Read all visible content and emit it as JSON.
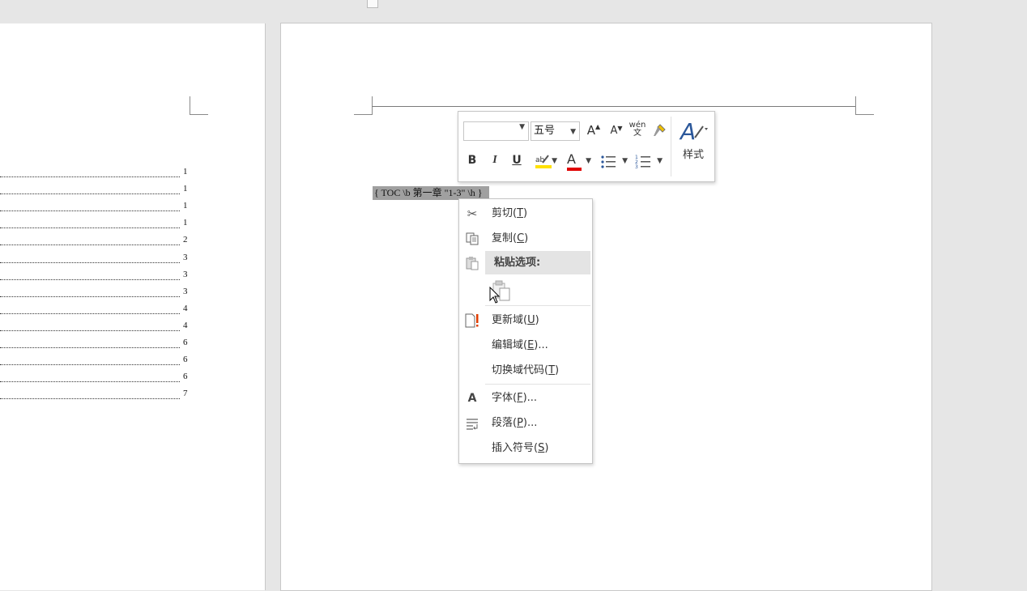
{
  "toc_page_numbers": [
    "1",
    "1",
    "1",
    "1",
    "2",
    "3",
    "3",
    "3",
    "4",
    "4",
    "6",
    "6",
    "6",
    "7"
  ],
  "field_code": "{ TOC \\b  第一章 \"1-3\" \\h }",
  "mini_toolbar": {
    "font_name": "",
    "font_size": "五号",
    "grow_font": "A",
    "shrink_font": "A",
    "phonetic_guide": "wén 文",
    "bold": "B",
    "italic": "I",
    "underline": "U",
    "font_color": "A",
    "styles_label": "样式",
    "highlight_color": "#ffe100",
    "font_color_value": "#e00000"
  },
  "context_menu": {
    "cut": {
      "label": "剪切(T)",
      "text": "剪切(",
      "key": "T"
    },
    "copy": {
      "label": "复制(C)",
      "text": "复制(",
      "key": "C"
    },
    "paste_options": "粘贴选项:",
    "update_field": {
      "text": "更新域(",
      "key": "U"
    },
    "edit_field": {
      "text": "编辑域(",
      "key": "E",
      "suffix": ")..."
    },
    "toggle_field_codes": {
      "text": "切换域代码(",
      "key": "T"
    },
    "font": {
      "text": "字体(",
      "key": "F",
      "suffix": ")..."
    },
    "paragraph": {
      "text": "段落(",
      "key": "P",
      "suffix": ")..."
    },
    "insert_symbol": {
      "text": "插入符号(",
      "key": "S"
    }
  },
  "icons": [
    "scissors-icon",
    "copy-icon",
    "paste-icon",
    "keep-text-only-icon",
    "update-field-icon",
    "font-icon",
    "paragraph-icon",
    "mouse-cursor-icon"
  ]
}
